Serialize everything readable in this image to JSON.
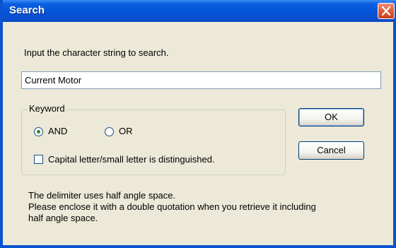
{
  "window": {
    "title": "Search"
  },
  "prompt": "Input the character string to search.",
  "search": {
    "value": "Current Motor"
  },
  "keyword": {
    "legend": "Keyword",
    "options": [
      {
        "label": "AND",
        "selected": true
      },
      {
        "label": "OR",
        "selected": false
      }
    ],
    "case_label": "Capital letter/small letter is distinguished.",
    "case_checked": false
  },
  "buttons": {
    "ok": "OK",
    "cancel": "Cancel"
  },
  "note": {
    "line1": "The delimiter uses half angle space.",
    "line2": "Please enclose it with a double quotation when you retrieve it including",
    "line3": "half angle space."
  },
  "colors": {
    "titlebar": "#0353d6",
    "face": "#ece9d8",
    "close": "#e0603f"
  }
}
